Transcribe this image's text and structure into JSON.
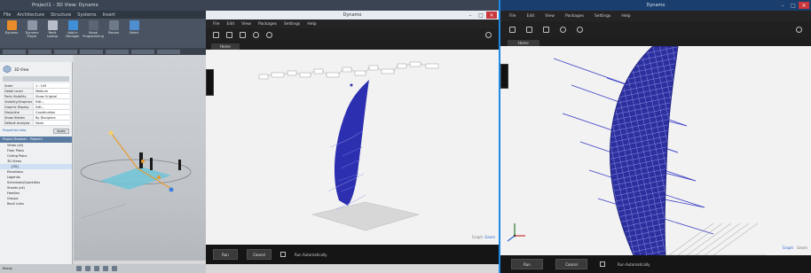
{
  "revit": {
    "title": "Project1 - 3D View: Dynamo",
    "menu": [
      "File",
      "Architecture",
      "Structure",
      "Systems",
      "Insert",
      "Annotate",
      "Analyze",
      "Massing",
      "Collaborate",
      "View",
      "Manage",
      "Add-Ins",
      "Modify"
    ],
    "ribbon_tools": [
      "Dynamo",
      "Dynamo Player",
      "Revit Lookup",
      "Add-In Manager",
      "Visual Programming",
      "Macros",
      "Select"
    ],
    "properties": {
      "header": "3D View",
      "rows": [
        {
          "k": "Scale",
          "v": "1 : 100"
        },
        {
          "k": "Detail Level",
          "v": "Medium"
        },
        {
          "k": "Parts Visibility",
          "v": "Show Original"
        },
        {
          "k": "Visibility/Graphics",
          "v": "Edit..."
        },
        {
          "k": "Graphic Display",
          "v": "Edit..."
        },
        {
          "k": "Discipline",
          "v": "Coordination"
        },
        {
          "k": "Show Hidden",
          "v": "By Discipline"
        },
        {
          "k": "Default Analysis",
          "v": "None"
        }
      ],
      "help_link": "Properties help",
      "apply_label": "Apply"
    },
    "browser": {
      "header": "Project Browser - Project1",
      "items": [
        "Views (all)",
        "Floor Plans",
        "Ceiling Plans",
        "3D Views",
        "{3D}",
        "Elevations",
        "Legends",
        "Schedules/Quantities",
        "Sheets (all)",
        "Families",
        "Groups",
        "Revit Links"
      ]
    },
    "status": "Ready"
  },
  "dynamo_small": {
    "title": "Dynamo",
    "menu": [
      "File",
      "Edit",
      "View",
      "Packages",
      "Settings",
      "Help"
    ],
    "tab": "Home",
    "zoom_labels": [
      "Graph",
      "Geom"
    ],
    "run_label": "Run",
    "cancel_label": "Cancel",
    "auto_label": "Run Automatically"
  },
  "dynamo_large": {
    "title": "Dynamo",
    "menu": [
      "File",
      "Edit",
      "View",
      "Packages",
      "Settings",
      "Help"
    ],
    "tab": "Home",
    "zoom_labels": [
      "Graph",
      "Geom"
    ],
    "run_label": "Run",
    "cancel_label": "Cancel",
    "auto_label": "Run Automatically"
  },
  "colors": {
    "accent": "#2f6bd3",
    "geometry_blue": "#2b2fb0",
    "close_red": "#c9363b",
    "revit_bar": "#3b4452"
  }
}
